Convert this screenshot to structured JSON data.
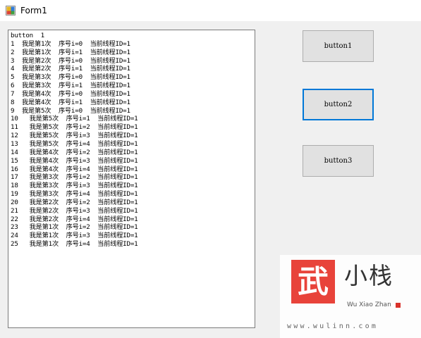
{
  "window": {
    "title": "Form1",
    "icon": "winforms-app-icon"
  },
  "output": {
    "lines": [
      "button  1",
      "1  我是第1次  序号i=0  当前线程ID=1",
      "2  我是第1次  序号i=1  当前线程ID=1",
      "3  我是第2次  序号i=0  当前线程ID=1",
      "4  我是第2次  序号i=1  当前线程ID=1",
      "5  我是第3次  序号i=0  当前线程ID=1",
      "6  我是第3次  序号i=1  当前线程ID=1",
      "7  我是第4次  序号i=0  当前线程ID=1",
      "8  我是第4次  序号i=1  当前线程ID=1",
      "9  我是第5次  序号i=0  当前线程ID=1",
      "10   我是第5次  序号i=1  当前线程ID=1",
      "11   我是第5次  序号i=2  当前线程ID=1",
      "12   我是第5次  序号i=3  当前线程ID=1",
      "13   我是第5次  序号i=4  当前线程ID=1",
      "14   我是第4次  序号i=2  当前线程ID=1",
      "15   我是第4次  序号i=3  当前线程ID=1",
      "16   我是第4次  序号i=4  当前线程ID=1",
      "17   我是第3次  序号i=2  当前线程ID=1",
      "18   我是第3次  序号i=3  当前线程ID=1",
      "19   我是第3次  序号i=4  当前线程ID=1",
      "20   我是第2次  序号i=2  当前线程ID=1",
      "21   我是第2次  序号i=3  当前线程ID=1",
      "22   我是第2次  序号i=4  当前线程ID=1",
      "23   我是第1次  序号i=2  当前线程ID=1",
      "24   我是第1次  序号i=3  当前线程ID=1",
      "25   我是第1次  序号i=4  当前线程ID=1"
    ]
  },
  "buttons": [
    {
      "label": "button1",
      "focused": false
    },
    {
      "label": "button2",
      "focused": true
    },
    {
      "label": "button3",
      "focused": false
    }
  ],
  "watermark": {
    "seal_char": "武",
    "brand_cn": "小栈",
    "brand_en": "Wu Xiao Zhan",
    "url": "www.wulinn.com",
    "accent": "#d9322b"
  },
  "colors": {
    "focus_border": "#0078d7",
    "button_face": "#e1e1e1"
  }
}
